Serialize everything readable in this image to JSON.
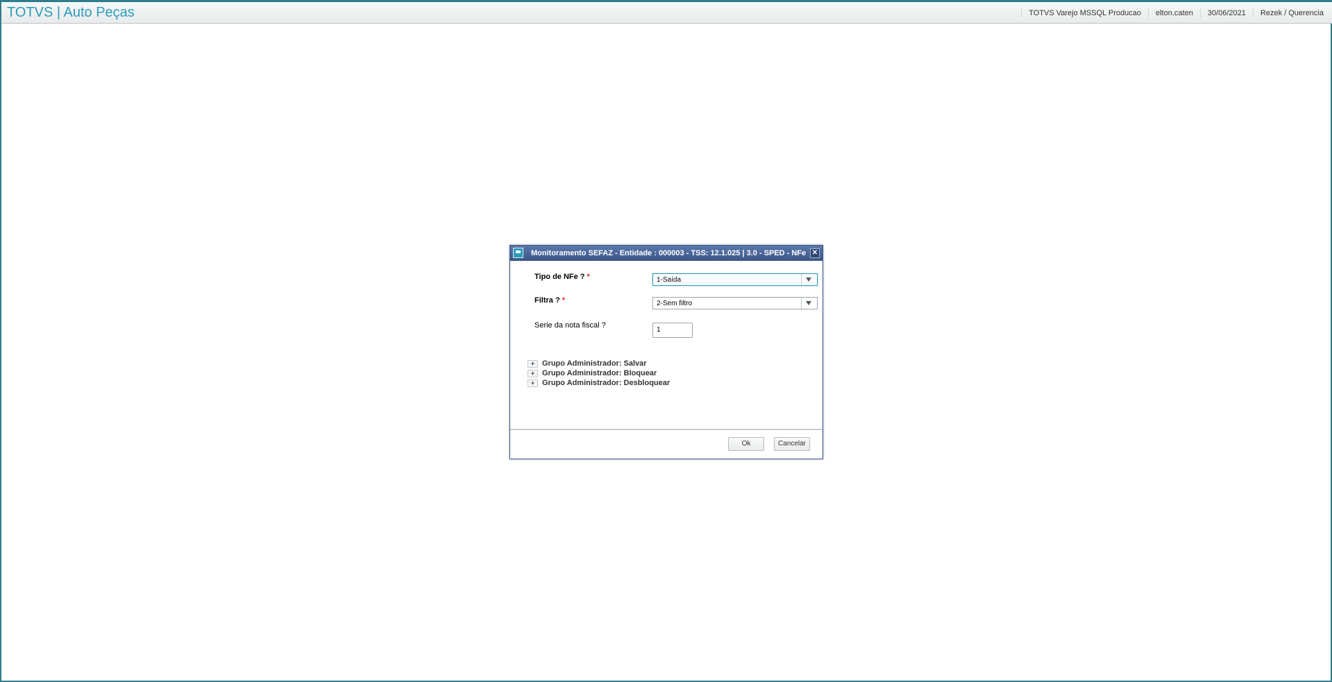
{
  "header": {
    "app_title": "TOTVS | Auto Peças",
    "environment": "TOTVS Varejo MSSQL Producao",
    "user": "elton.caten",
    "date": "30/06/2021",
    "branch": "Rezek / Querencia"
  },
  "dialog": {
    "icon": "window-icon",
    "title": "Monitoramento SEFAZ - Entidade : 000003 - TSS: 12.1.025 | 3.0 - SPED - NFe",
    "close_glyph": "✕",
    "fields": {
      "tipo_label": "Tipo de NFe ?",
      "tipo_value": "1-Saída",
      "filtra_label": "Filtra ?",
      "filtra_value": "2-Sem filtro",
      "serie_label": "Serie da nota fiscal ?",
      "serie_value": "1",
      "required_mark": "*"
    },
    "groups": [
      {
        "expander": "+",
        "label": "Grupo Administrador: Salvar"
      },
      {
        "expander": "+",
        "label": "Grupo Administrador: Bloquear"
      },
      {
        "expander": "+",
        "label": "Grupo Administrador: Desbloquear"
      }
    ],
    "ok_label": "Ok",
    "cancel_label": "Cancelar"
  },
  "colors": {
    "accent": "#2a9bbb",
    "dialog_header": "#3b5687",
    "required": "#e02020"
  }
}
